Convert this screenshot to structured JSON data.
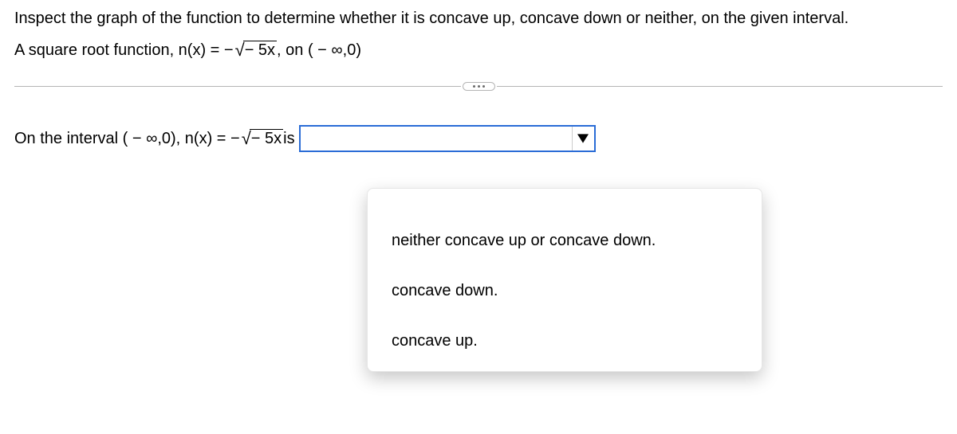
{
  "question": {
    "line1": "Inspect the graph of the function to determine whether it is concave up, concave down or neither, on the given interval.",
    "line2_prefix": "A square root function, n(x) = − ",
    "radicand": "− 5x",
    "line2_suffix": ", on ( − ∞,0)"
  },
  "answer": {
    "prefix": "On the interval ( − ∞,0), n(x) = − ",
    "radicand": "− 5x",
    "suffix": " is",
    "selected": ""
  },
  "options": [
    "neither concave up or concave down.",
    "concave down.",
    "concave up."
  ]
}
